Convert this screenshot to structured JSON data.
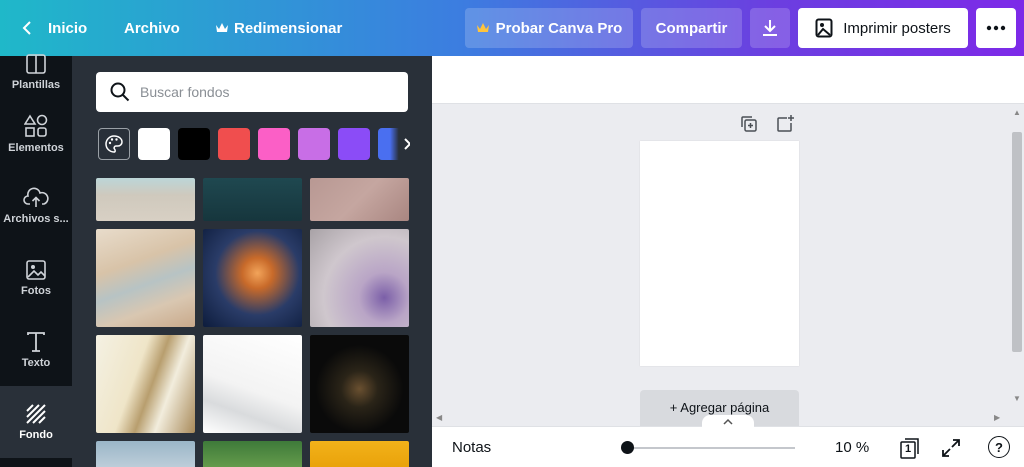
{
  "topbar": {
    "home_label": "Inicio",
    "file_label": "Archivo",
    "resize_label": "Redimensionar",
    "try_pro_label": "Probar Canva Pro",
    "share_label": "Compartir",
    "print_label": "Imprimir posters"
  },
  "rail": {
    "items": [
      {
        "label": "Plantillas",
        "icon": "template-icon"
      },
      {
        "label": "Elementos",
        "icon": "shapes-icon"
      },
      {
        "label": "Archivos s...",
        "icon": "cloud-upload-icon"
      },
      {
        "label": "Fotos",
        "icon": "image-icon"
      },
      {
        "label": "Texto",
        "icon": "text-icon"
      },
      {
        "label": "Fondo",
        "icon": "background-icon",
        "active": true
      }
    ]
  },
  "panel": {
    "search_placeholder": "Buscar fondos",
    "swatches": [
      "#ffffff",
      "#000000",
      "#f04e4e",
      "#fb5fc6",
      "#c86ee6",
      "#8b4cf7",
      "#4a6ff0"
    ]
  },
  "canvas": {
    "add_page_label": "+ Agregar página"
  },
  "bottombar": {
    "notes_label": "Notas",
    "zoom_label": "10 %",
    "page_count": "1",
    "help_label": "?"
  }
}
